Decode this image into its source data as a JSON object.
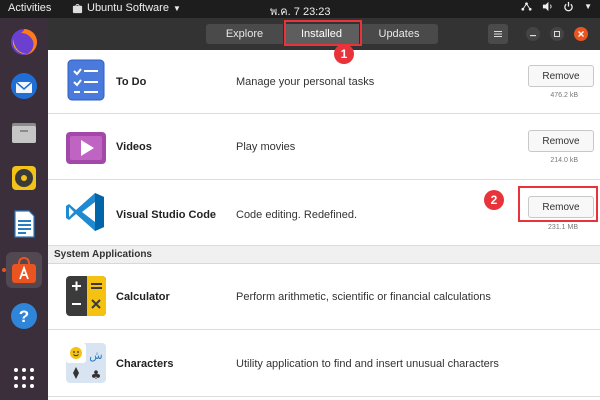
{
  "topbar": {
    "activities": "Activities",
    "app_name": "Ubuntu Software",
    "clock": "พ.ค. 7  23:23"
  },
  "tabs": [
    {
      "label": "Explore",
      "active": false
    },
    {
      "label": "Installed",
      "active": true
    },
    {
      "label": "Updates",
      "active": false
    }
  ],
  "dock": {
    "items": [
      "firefox-icon",
      "thunderbird-icon",
      "files-icon",
      "rhythmbox-icon",
      "libreoffice-writer-icon",
      "ubuntu-software-icon",
      "help-icon",
      "show-apps-icon"
    ]
  },
  "apps": [
    {
      "name": "To Do",
      "description": "Manage your personal tasks",
      "action": "Remove",
      "size": "476.2 kB",
      "icon": "todo-icon"
    },
    {
      "name": "Videos",
      "description": "Play movies",
      "action": "Remove",
      "size": "214.0 kB",
      "icon": "videos-icon"
    },
    {
      "name": "Visual Studio Code",
      "description": "Code editing. Redefined.",
      "action": "Remove",
      "size": "231.1 MB",
      "icon": "vscode-icon"
    }
  ],
  "section": {
    "title": "System Applications"
  },
  "system_apps": [
    {
      "name": "Calculator",
      "description": "Perform arithmetic, scientific or financial calculations",
      "icon": "calculator-icon"
    },
    {
      "name": "Characters",
      "description": "Utility application to find and insert unusual characters",
      "icon": "characters-icon"
    }
  ],
  "annotations": [
    {
      "number": "1"
    },
    {
      "number": "2"
    }
  ],
  "colors": {
    "accent": "#e95420",
    "annotation": "#e8333a",
    "headerbar": "#333333"
  }
}
